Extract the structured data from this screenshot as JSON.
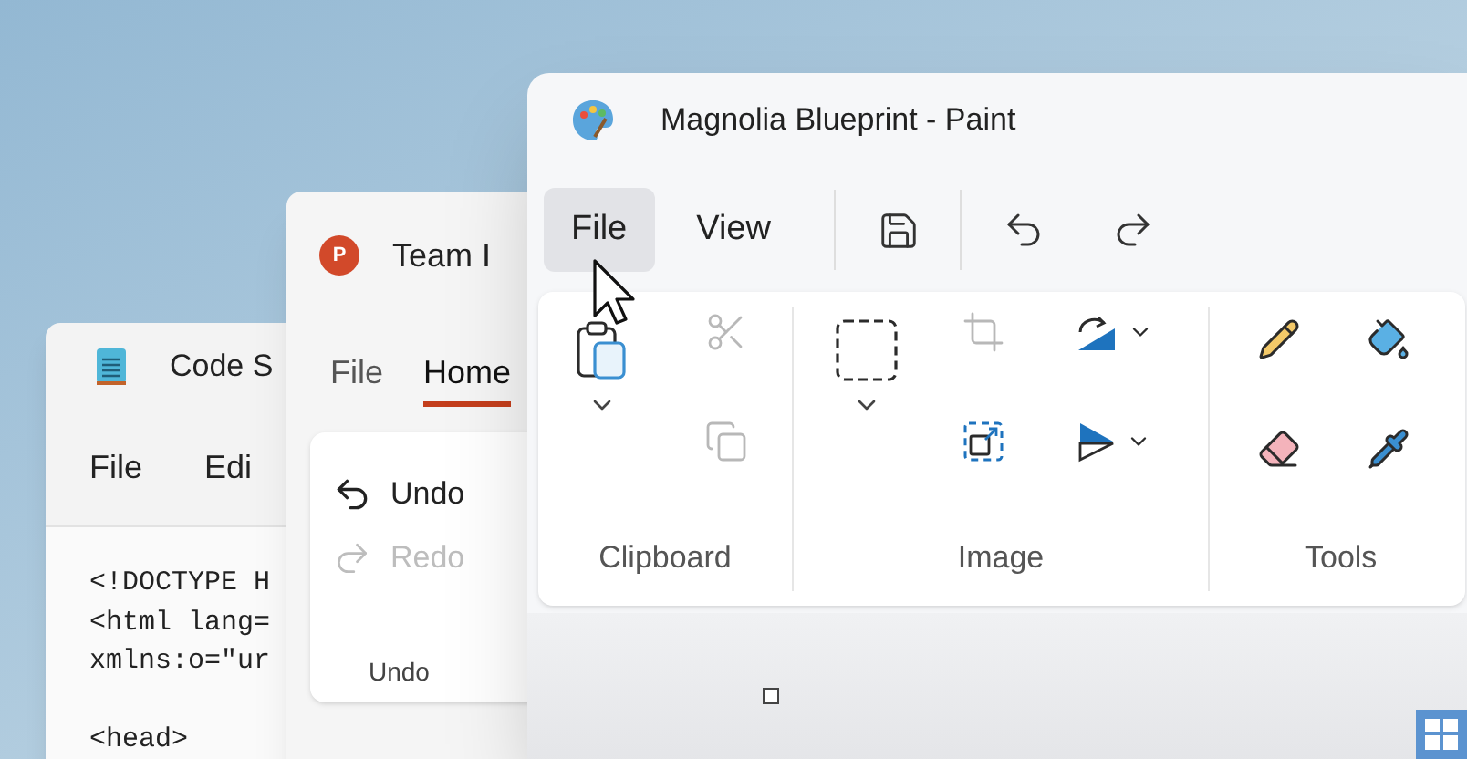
{
  "notepad": {
    "title": "Code S",
    "menu": [
      {
        "label": "File"
      },
      {
        "label": "Edi"
      }
    ],
    "code_blocks": [
      [
        "<!DOCTYPE H",
        "<html lang=",
        "xmlns:o=\"ur"
      ],
      [
        "<head>"
      ]
    ]
  },
  "presentation": {
    "app_icon_letter": "P",
    "title": "Team I",
    "tabs": [
      {
        "label": "File",
        "selected": false
      },
      {
        "label": "Home",
        "selected": true
      }
    ],
    "undo_group": {
      "label": "Undo",
      "items": [
        {
          "label": "Undo",
          "disabled": false
        },
        {
          "label": "Redo",
          "disabled": true
        }
      ]
    }
  },
  "paint": {
    "title": "Magnolia Blueprint - Paint",
    "menu": [
      {
        "label": "File",
        "hovered": true
      },
      {
        "label": "View",
        "hovered": false
      }
    ],
    "ribbon": [
      {
        "label": "Clipboard",
        "tools": [
          {
            "disabled": false
          },
          {
            "disabled": true
          },
          {
            "disabled": true
          }
        ]
      },
      {
        "label": "Image",
        "tools": [
          {
            "disabled": false
          },
          {
            "disabled": true
          },
          {
            "disabled": false
          },
          {
            "disabled": false
          },
          {
            "disabled": false
          }
        ]
      },
      {
        "label": "Tools",
        "tools": [
          {
            "disabled": false
          },
          {
            "disabled": false
          },
          {
            "disabled": false
          },
          {
            "disabled": false
          }
        ]
      }
    ]
  }
}
